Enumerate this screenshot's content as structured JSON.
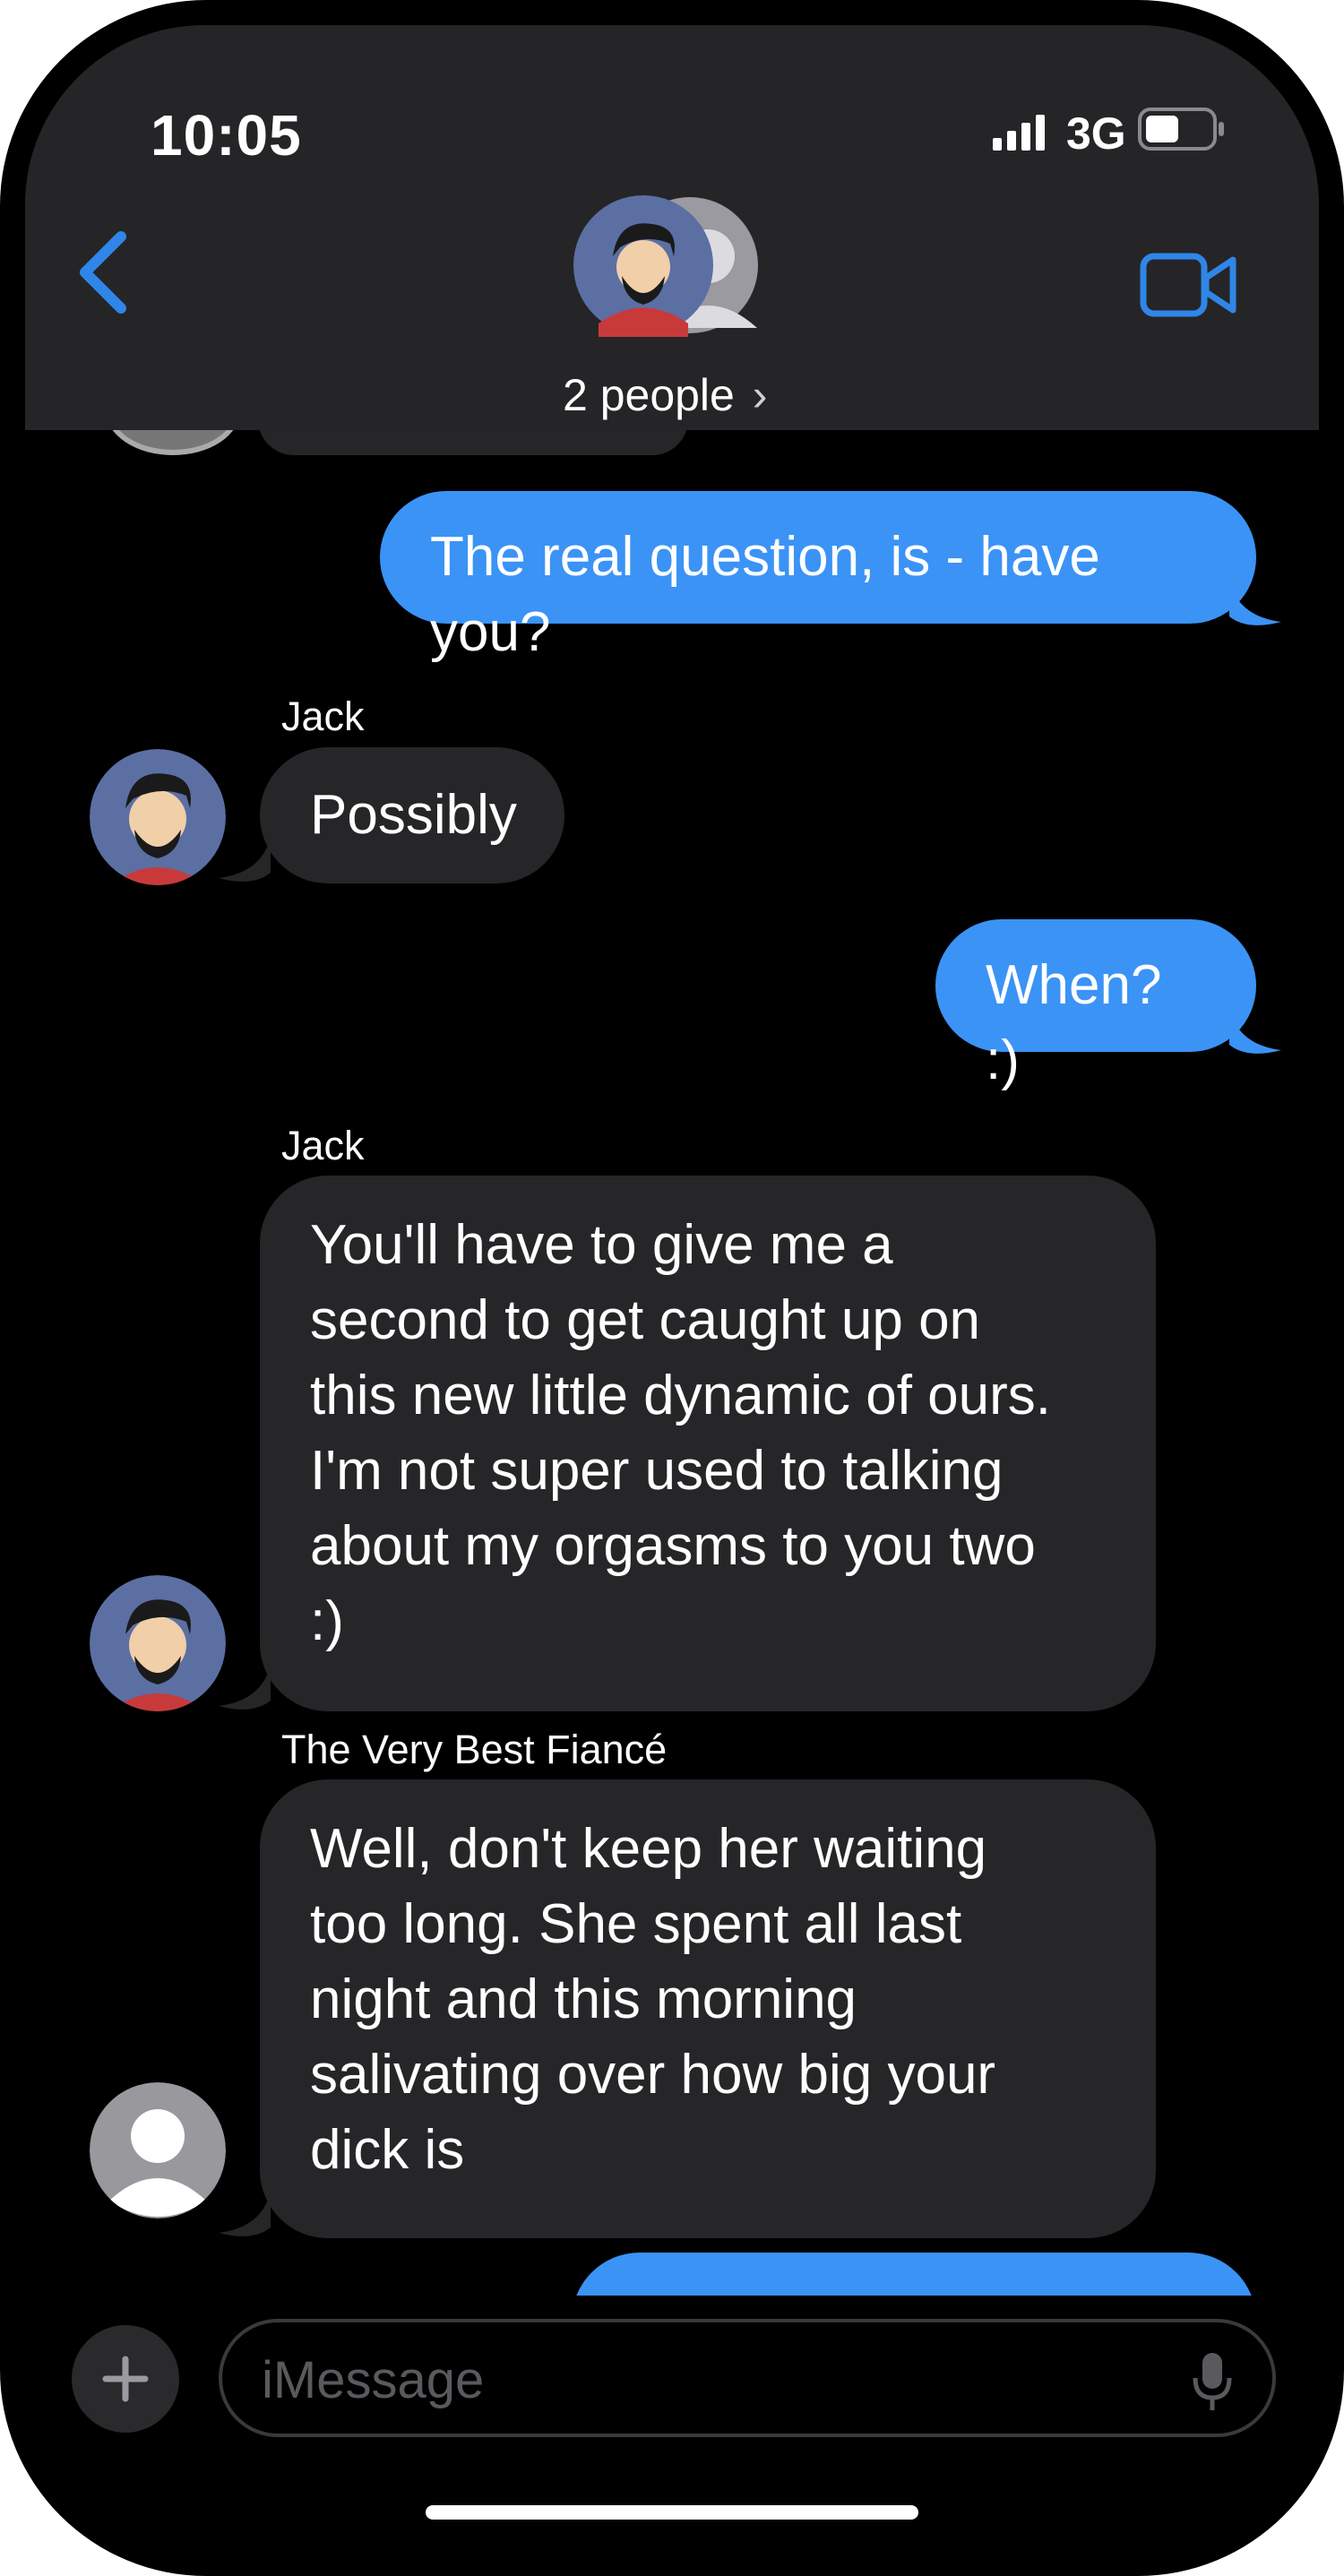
{
  "status_bar": {
    "time": "10:05",
    "network": "3G"
  },
  "header": {
    "people_label": "2 people",
    "chevron": "›"
  },
  "messages": [
    {
      "text": "The real question, is - have you?"
    },
    {
      "sender": "Jack",
      "text": "Possibly"
    },
    {
      "text": "When? :)"
    },
    {
      "sender": "Jack",
      "text": "You'll have to give me a\nsecond to get caught up on\nthis new little dynamic of ours.\nI'm not super used to talking\nabout my orgasms to you two\n:)"
    },
    {
      "sender": "The Very Best Fiancé",
      "text": "Well, don't keep her waiting\ntoo long.  She spent all last\nnight and this morning\nsalivating over how big your\ndick is"
    }
  ],
  "input": {
    "placeholder": "iMessage"
  },
  "colors": {
    "outgoing": "#3b93f6",
    "incoming": "#262628",
    "header": "#252527",
    "accent": "#2f86e8"
  },
  "icons": [
    "signal-icon",
    "battery-icon",
    "back-chevron-icon",
    "video-call-icon",
    "plus-icon",
    "microphone-icon",
    "person-placeholder-icon"
  ]
}
